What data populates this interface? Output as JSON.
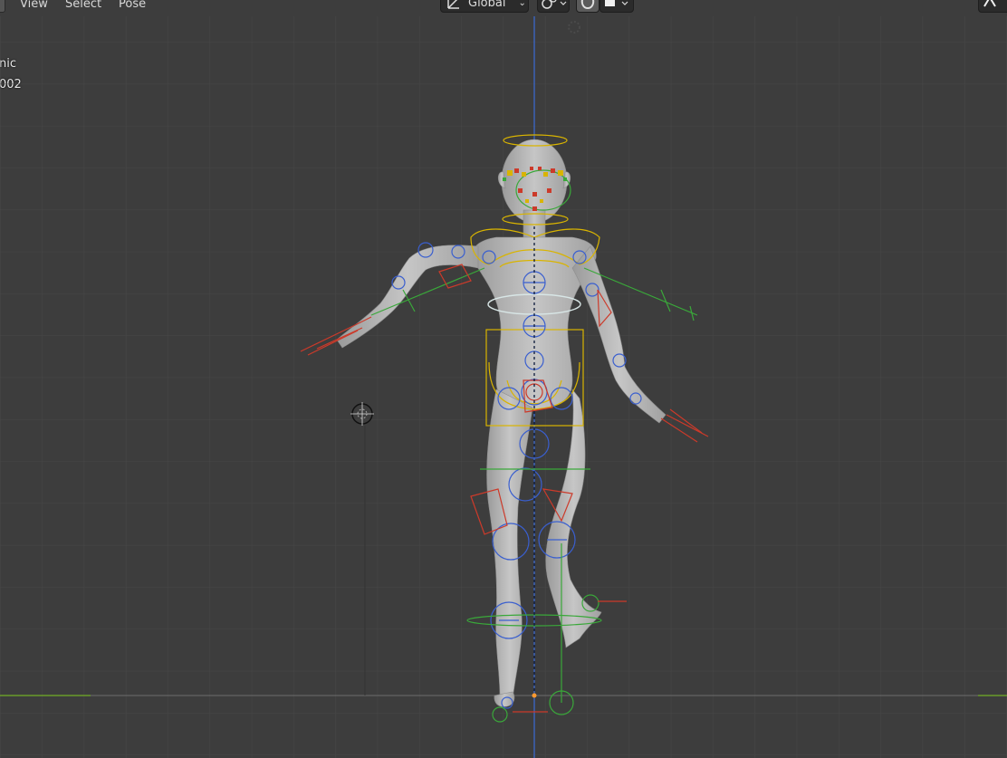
{
  "header": {
    "menus": [
      {
        "label": "View"
      },
      {
        "label": "Select"
      },
      {
        "label": "Pose"
      }
    ],
    "orientation": {
      "label": "Global"
    }
  },
  "viewport": {
    "overlay_line1": "nic",
    "overlay_line2": "002"
  },
  "colors": {
    "background": "#3d3d3d",
    "grid": "#4a4a4a",
    "x_axis": "#6a9b2a",
    "z_axis": "#3b6bd4",
    "body": "#b8b8b8",
    "bone_blue": "#3a5fcf",
    "bone_yellow": "#d9b400",
    "bone_red": "#cc3a2a",
    "bone_green": "#3aa83a"
  },
  "icons": {
    "transform_orientation": "orientation-axes-icon",
    "snap": "magnet-icon",
    "proportional": "proportional-editing-icon",
    "light": "light-icon",
    "cursor": "3d-cursor-icon"
  }
}
